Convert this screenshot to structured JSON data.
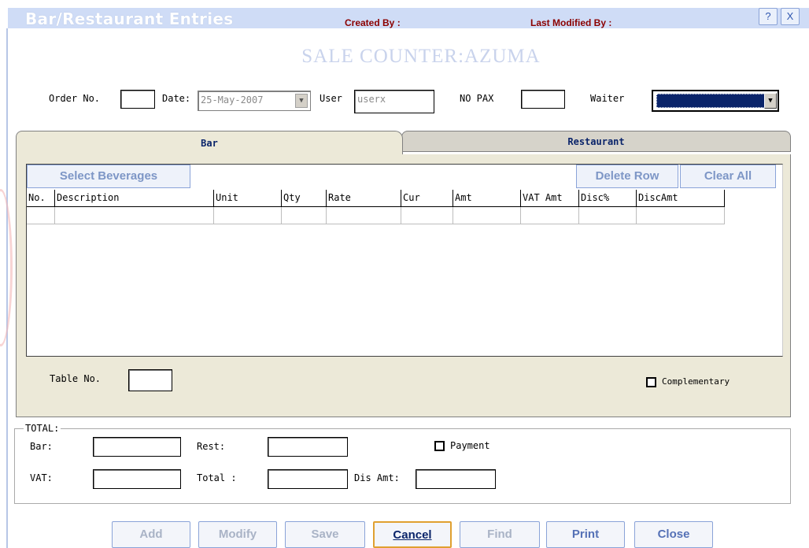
{
  "window": {
    "title": "Bar/Restaurant Entries",
    "created_by_label": "Created By :",
    "last_modified_by_label": "Last Modified By :",
    "help_button": "?",
    "close_button": "X"
  },
  "counter_title": "SALE COUNTER:AZUMA",
  "header_fields": {
    "order_no_label": "Order No.",
    "order_no_value": "",
    "date_label": "Date:",
    "date_value": "25-May-2007",
    "user_label": "User",
    "user_value": "userx",
    "no_pax_label": "NO PAX",
    "no_pax_value": "",
    "waiter_label": "Waiter",
    "waiter_value": ""
  },
  "tabs": [
    {
      "label": "Bar",
      "active": true
    },
    {
      "label": "Restaurant",
      "active": false
    }
  ],
  "grid": {
    "select_beverages_label": "Select Beverages",
    "delete_row_label": "Delete Row",
    "clear_all_label": "Clear All",
    "columns": [
      "No.",
      "Description",
      "Unit",
      "Qty",
      "Rate",
      "Cur",
      "Amt",
      "VAT Amt",
      "Disc%",
      "DiscAmt"
    ]
  },
  "table_no_label": "Table No.",
  "table_no_value": "",
  "complementary_label": "Complementary",
  "totals": {
    "legend": "TOTAL:",
    "bar_label": "Bar:",
    "rest_label": "Rest:",
    "payment_label": "Payment",
    "vat_label": "VAT:",
    "total_label": "Total :",
    "dis_amt_label": "Dis Amt:"
  },
  "buttons": {
    "add": "Add",
    "modify": "Modify",
    "save": "Save",
    "cancel": "Cancel",
    "find": "Find",
    "print": "Print",
    "close": "Close"
  },
  "colors": {
    "title_bar": "#cfdcf6",
    "waiter_selected": "#0a246a",
    "meta_label": "#8b0000"
  }
}
